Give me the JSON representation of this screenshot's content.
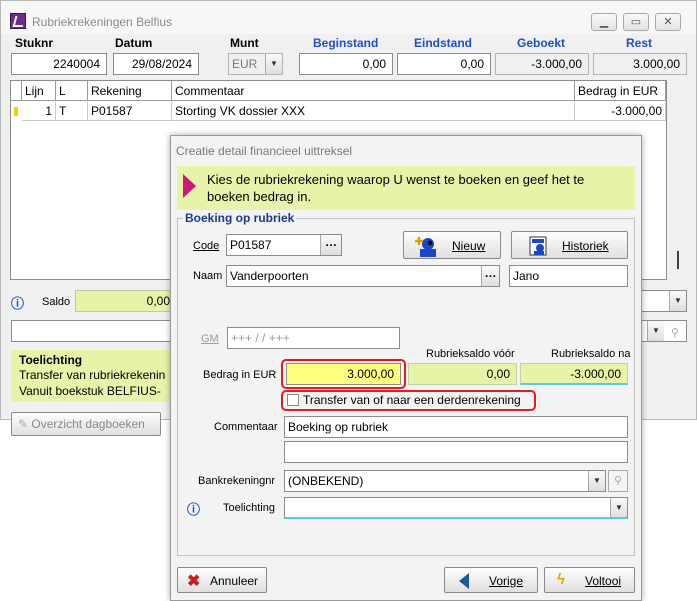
{
  "main_window": {
    "title": "Rubriekrekeningen Belfius",
    "caption_buttons": [
      "minimize-icon",
      "maximize-icon",
      "close-icon"
    ],
    "headers": {
      "stuknr": "Stuknr",
      "datum": "Datum",
      "munt": "Munt",
      "beginstand": "Beginstand",
      "eindstand": "Eindstand",
      "geboekt": "Geboekt",
      "rest": "Rest"
    },
    "values": {
      "stuknr": "2240004",
      "datum": "29/08/2024",
      "munt": "EUR",
      "beginstand": "0,00",
      "eindstand": "0,00",
      "geboekt": "-3.000,00",
      "rest": "3.000,00"
    },
    "grid": {
      "columns": [
        "Lijn",
        "L",
        "Rekening",
        "Commentaar",
        "Bedrag in EUR"
      ],
      "rows": [
        {
          "lijn": "1",
          "l": "T",
          "rekening": "P01587",
          "commentaar": "Storting VK dossier XXX",
          "bedrag": "-3.000,00"
        }
      ]
    },
    "saldo_label": "Saldo",
    "saldo_value": "0,00",
    "toelichting": {
      "title": "Toelichting",
      "line1": "Transfer van rubriekrekenin",
      "line2": "Vanuit boekstuk BELFIUS-"
    },
    "overzicht_button": "Overzicht dagboeken"
  },
  "dialog": {
    "title": "Creatie detail financieel uittreksel",
    "banner_text": "Kies de rubriekrekening waarop U wenst te boeken en geef het te boeken bedrag in.",
    "group_title": "Boeking op rubriek",
    "code_label": "Code",
    "code_value": "P01587",
    "nieuw_button": "Nieuw",
    "historiek_button": "Historiek",
    "naam_label": "Naam",
    "naam_value": "Vanderpoorten",
    "voornaam_value": "Jano",
    "gm_label": "GM",
    "gm_value": "+++   /    /     +++",
    "rubrieksaldo_voor_label": "Rubrieksaldo vóór",
    "rubrieksaldo_na_label": "Rubrieksaldo na",
    "bedrag_label": "Bedrag in EUR",
    "bedrag_value": "3.000,00",
    "rubrieksaldo_voor_value": "0,00",
    "rubrieksaldo_na_value": "-3.000,00",
    "transfer_checkbox_label": "Transfer van of naar een derdenrekening",
    "transfer_checked": false,
    "commentaar_label": "Commentaar",
    "commentaar_value": "Boeking op rubriek",
    "commentaar2_value": "",
    "bankrekeningnr_label": "Bankrekeningnr",
    "bankrekeningnr_value": "(ONBEKEND)",
    "toelichting_label": "Toelichting",
    "toelichting_value": "",
    "annuleer_button": "Annuleer",
    "vorige_button": "Vorige",
    "voltooi_button": "Voltooi"
  },
  "colors": {
    "accent_blue": "#1c4fc8",
    "highlight_yellow": "#ffff80",
    "readonly_green": "#e7f3a8",
    "annotation_red": "#e01e1e",
    "banner_arrow": "#d0187a"
  }
}
